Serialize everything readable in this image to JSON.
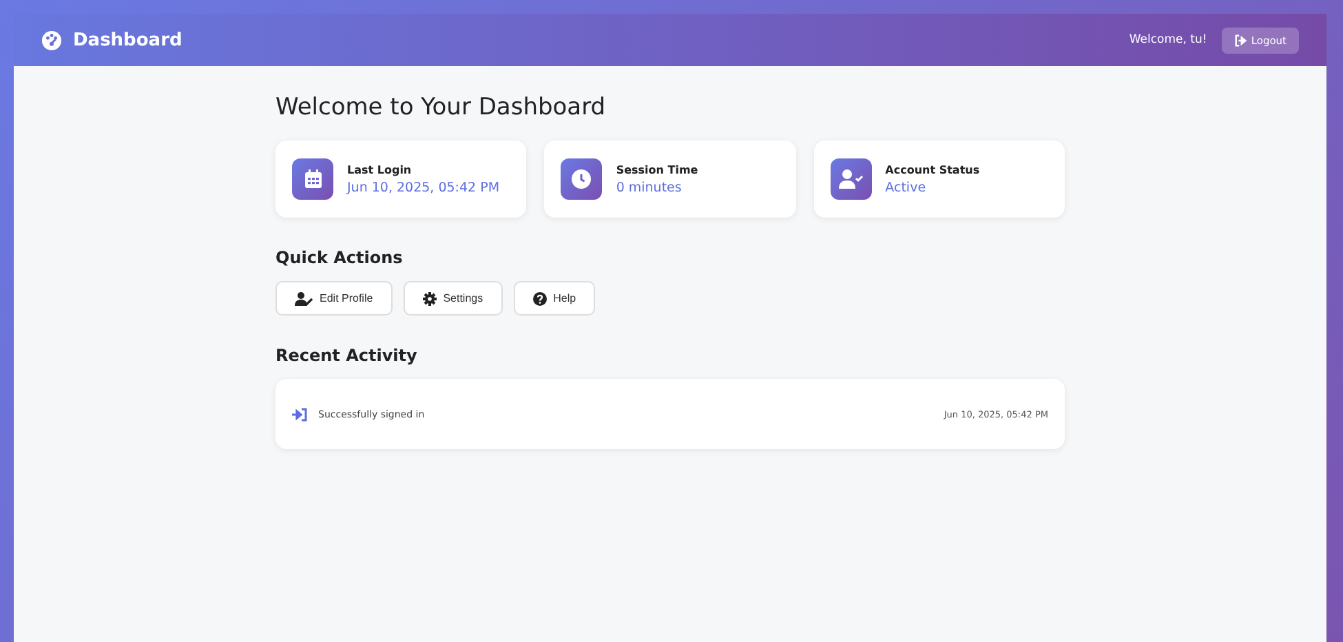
{
  "header": {
    "title": "Dashboard",
    "welcome": "Welcome, tu!",
    "logout": "Logout"
  },
  "page_title": "Welcome to Your Dashboard",
  "stats": [
    {
      "kind": "login",
      "label": "Last Login",
      "value": "Jun 10, 2025, 05:42 PM"
    },
    {
      "kind": "session",
      "label": "Session Time",
      "value": "0 minutes"
    },
    {
      "kind": "status",
      "label": "Account Status",
      "value": "Active"
    }
  ],
  "quick_actions": {
    "title": "Quick Actions",
    "buttons": [
      {
        "kind": "profile",
        "label": "Edit Profile"
      },
      {
        "kind": "settings",
        "label": "Settings"
      },
      {
        "kind": "help",
        "label": "Help"
      }
    ]
  },
  "recent_activity": {
    "title": "Recent Activity",
    "items": [
      {
        "kind": "signin",
        "text": "Successfully signed in",
        "time": "Jun 10, 2025, 05:42 PM"
      }
    ]
  }
}
